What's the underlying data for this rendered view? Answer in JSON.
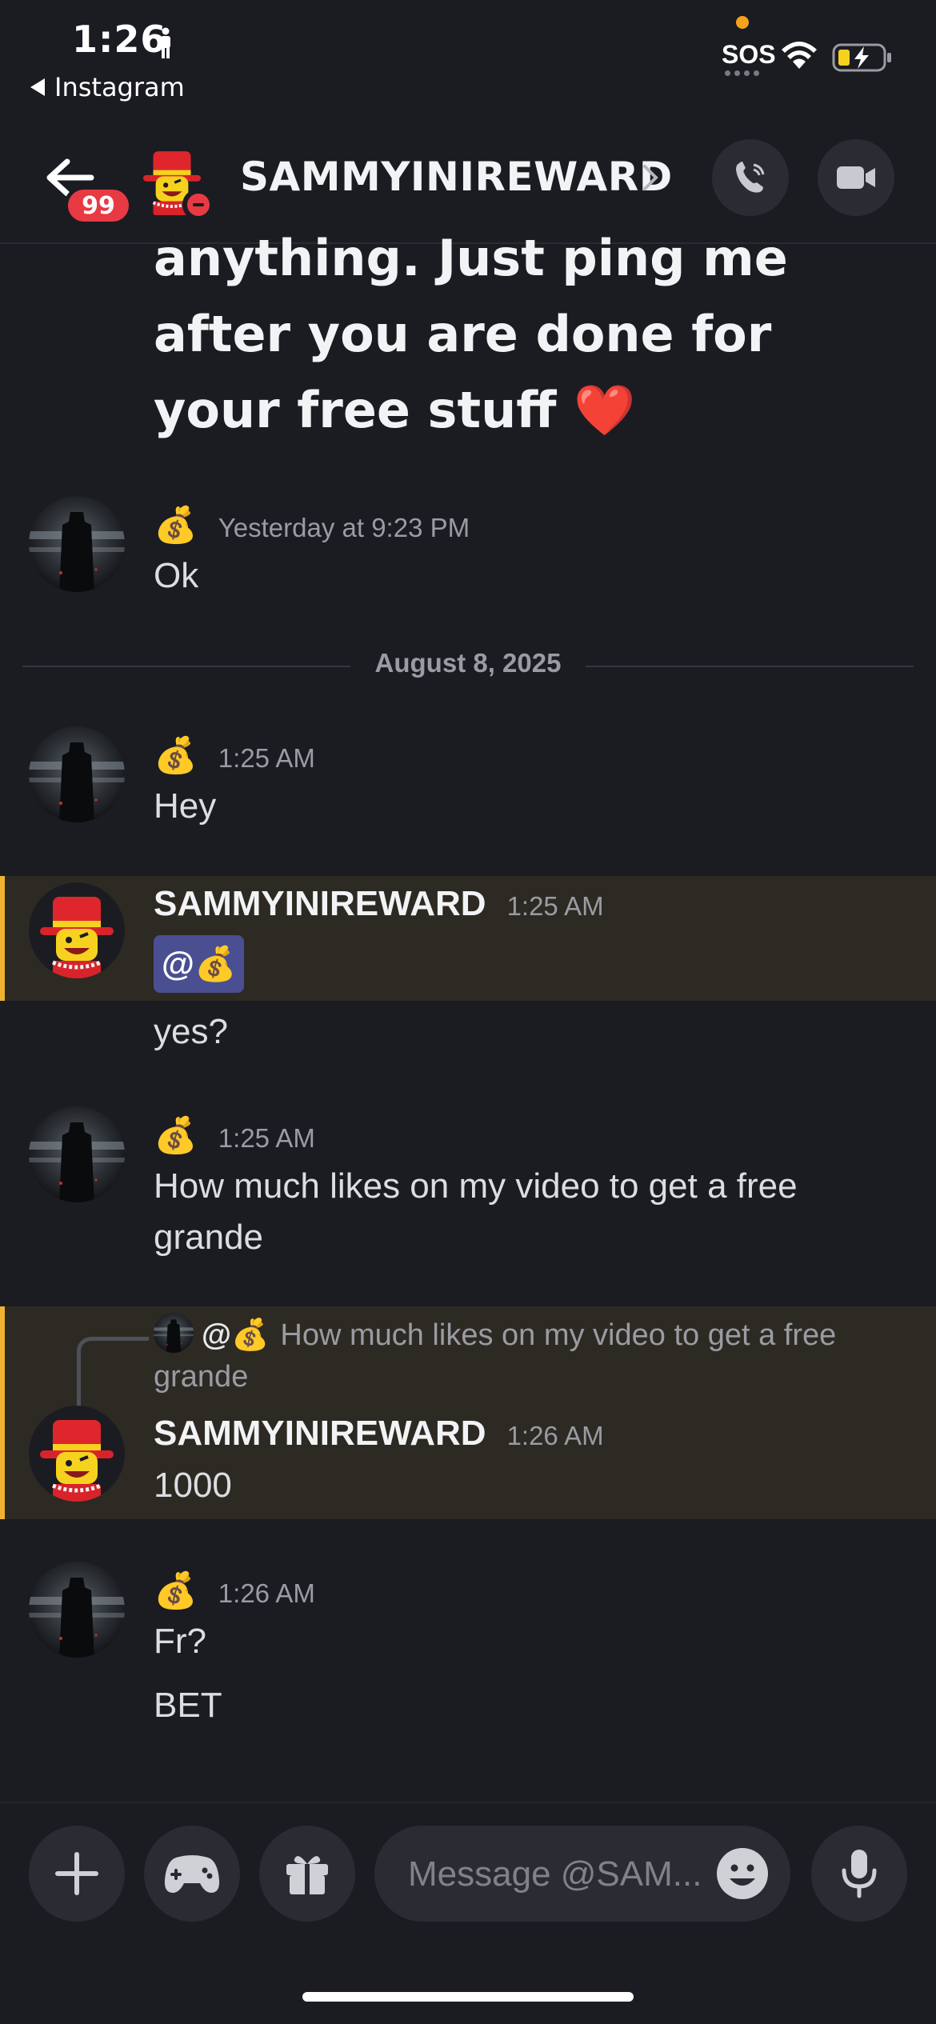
{
  "status_bar": {
    "time": "1:26",
    "back_app": "Instagram",
    "sos": "SOS"
  },
  "header": {
    "unread_badge": "99",
    "title": "SAMMYINIREWARD"
  },
  "continued_text": "anything. Just ping me after you are done for your free stuff ❤️",
  "date_separator": "August 8, 2025",
  "messages": [
    {
      "author_emoji": "💰",
      "timestamp": "Yesterday at 9:23 PM",
      "lines": [
        "Ok"
      ]
    },
    {
      "author_emoji": "💰",
      "timestamp": "1:25 AM",
      "lines": [
        "Hey"
      ]
    },
    {
      "author": "SAMMYINIREWARD",
      "timestamp": "1:25 AM",
      "mention": "@💰",
      "lines": [
        "yes?"
      ]
    },
    {
      "author_emoji": "💰",
      "timestamp": "1:25 AM",
      "lines": [
        "How much likes on my video to get a free grande"
      ]
    },
    {
      "reply_to": {
        "mention": "@💰",
        "text": "How much likes on my video to get a free grande"
      },
      "author": "SAMMYINIREWARD",
      "timestamp": "1:26 AM",
      "lines": [
        "1000"
      ]
    },
    {
      "author_emoji": "💰",
      "timestamp": "1:26 AM",
      "lines": [
        "Fr?",
        "BET"
      ]
    }
  ],
  "composer": {
    "placeholder": "Message @SAM..."
  },
  "icons": {
    "add": "plus-icon",
    "games": "gamepad-icon",
    "gift": "gift-icon",
    "emoji": "emoji-icon",
    "voice": "microphone-icon",
    "call": "phone-icon",
    "video": "video-camera-icon"
  },
  "colors": {
    "background": "#1b1c22",
    "highlight_bg": "#2d2a24",
    "highlight_bar": "#f0b232",
    "badge_red": "#e83a43",
    "mention_bg": "#4a4f92"
  }
}
